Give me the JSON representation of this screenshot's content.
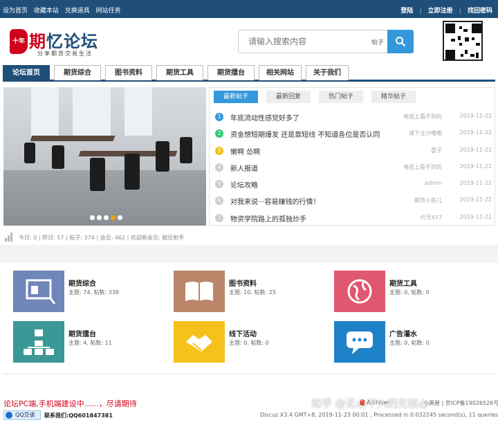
{
  "topbar": {
    "links": [
      "设为首页",
      "收藏本站",
      "兑换道具",
      "网站任务"
    ],
    "login": "登陆",
    "register": "立即注册",
    "recover": "找回密码",
    "separator": "|"
  },
  "logo": {
    "seal_text": "十年",
    "name_red": "期",
    "name_rest": "忆论坛",
    "slogan": "分享期货交易生活"
  },
  "search": {
    "placeholder": "请输入搜索内容",
    "type": "帖子",
    "button_icon": "search-icon"
  },
  "qr_icon": "qr-code-icon",
  "nav": {
    "tabs": [
      "论坛首页",
      "期货综合",
      "图书资料",
      "期货工具",
      "期货擂台",
      "相关网站",
      "关于我们"
    ],
    "active_index": 0
  },
  "slider": {
    "dot_count": 5,
    "active_dot": 3
  },
  "posts": {
    "tabs": [
      "最新帖子",
      "最新回复",
      "热门帖子",
      "精华帖子"
    ],
    "active_tab": 0,
    "items": [
      {
        "num": "1",
        "title": "年底流动性感觉好多了",
        "author": "电视上看不到的",
        "date": "2019-11-22",
        "color": "#3498db"
      },
      {
        "num": "2",
        "title": "资金想短期爆发 还是靠短线 不知道各位是否认同",
        "author": "请下注沙嘞嘞",
        "date": "2019-11-22",
        "color": "#2ecc71"
      },
      {
        "num": "3",
        "title": "懒啊 怂啊",
        "author": "雷子",
        "date": "2019-11-22",
        "color": "#f1c40f"
      },
      {
        "num": "4",
        "title": "新人报道",
        "author": "电视上看不到的",
        "date": "2019-11-22",
        "color": "#cccccc"
      },
      {
        "num": "5",
        "title": "论坛攻略",
        "author": "admin",
        "date": "2019-11-22",
        "color": "#cccccc"
      },
      {
        "num": "6",
        "title": "对我来说···容易赚钱的行情！",
        "author": "期货小鱼儿",
        "date": "2019-11-22",
        "color": "#cccccc"
      },
      {
        "num": "7",
        "title": "物资学院路上的孤独炒手",
        "author": "代号477",
        "date": "2019-11-21",
        "color": "#cccccc"
      }
    ]
  },
  "stats": {
    "text": "今日: 0 | 昨日: 57 | 帖子: 374 | 会员: 462 | 欢迎新会员: 豌豆射手"
  },
  "forums": [
    {
      "name": "期货综合",
      "meta": "主题: 74, 帖数: 338",
      "color": "#6f86b8",
      "icon": "presentation-icon"
    },
    {
      "name": "图书资料",
      "meta": "主题: 10, 帖数: 25",
      "color": "#b9866a",
      "icon": "open-book-icon"
    },
    {
      "name": "期货工具",
      "meta": "主题: 0, 帖数: 0",
      "color": "#e05770",
      "icon": "globe-icon"
    },
    {
      "name": "期货擂台",
      "meta": "主题: 4, 帖数: 11",
      "color": "#3a9896",
      "icon": "org-chart-icon"
    },
    {
      "name": "线下活动",
      "meta": "主题: 0, 帖数: 0",
      "color": "#f5c21b",
      "icon": "handshake-icon"
    },
    {
      "name": "广告灌水",
      "meta": "主题: 0, 帖数: 0",
      "color": "#1f82c8",
      "icon": "chat-bubble-icon"
    }
  ],
  "footer": {
    "notice": "论坛PC端,手机端建设中......，尽请期待",
    "qq_label": "QQ交谈",
    "contact": "联系我们:QQ601847381",
    "archiver": "Archiver",
    "license": "小黑屋 | 京ICP备19026526号-1",
    "discuz": "Discuz X3.4 GMT+8, 2019-11-23 00:01 , Processed in 0.032245 second(s), 11 queries .",
    "watermark": "知乎 @无心不入的无核心"
  }
}
